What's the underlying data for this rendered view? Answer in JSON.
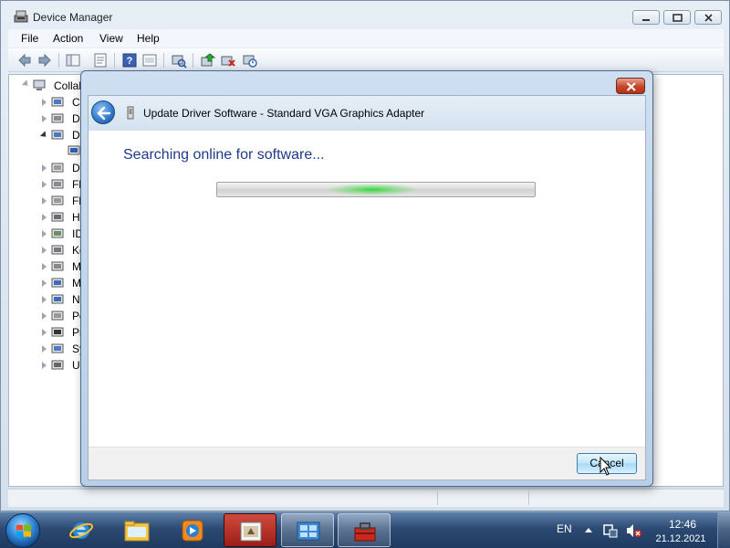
{
  "window": {
    "title": "Device Manager",
    "icon": "device-manager-icon",
    "caption_buttons": [
      "minimize",
      "maximize",
      "close"
    ]
  },
  "menu": {
    "items": [
      {
        "label": "File"
      },
      {
        "label": "Action"
      },
      {
        "label": "View"
      },
      {
        "label": "Help"
      }
    ]
  },
  "toolbar": {
    "buttons": [
      "back-arrow-icon",
      "forward-arrow-icon",
      "properties-pane-icon",
      "properties-sheet-icon",
      "help-icon",
      "show-hidden-icon",
      "scan-hardware-icon",
      "update-driver-icon",
      "uninstall-device-icon",
      "disable-device-icon"
    ]
  },
  "tree": {
    "root": {
      "label": "Collab"
    },
    "categories": [
      {
        "label": "Co",
        "icon": "computer-icon"
      },
      {
        "label": "Di",
        "icon": "disk-drive-icon"
      },
      {
        "label": "Di",
        "icon": "display-adapter-icon",
        "expanded": true
      },
      {
        "label": "DV",
        "icon": "dvd-drive-icon"
      },
      {
        "label": "Fl",
        "icon": "floppy-controller-icon"
      },
      {
        "label": "Fl",
        "icon": "floppy-drive-icon"
      },
      {
        "label": "Hu",
        "icon": "hid-icon"
      },
      {
        "label": "ID",
        "icon": "ide-controller-icon"
      },
      {
        "label": "Ke",
        "icon": "keyboard-icon"
      },
      {
        "label": "M",
        "icon": "mouse-icon"
      },
      {
        "label": "M",
        "icon": "monitor-icon"
      },
      {
        "label": "Ne",
        "icon": "network-adapter-icon"
      },
      {
        "label": "Po",
        "icon": "ports-icon"
      },
      {
        "label": "Pr",
        "icon": "processor-icon"
      },
      {
        "label": "Sy",
        "icon": "system-devices-icon"
      },
      {
        "label": "Ur",
        "icon": "usb-controller-icon"
      }
    ]
  },
  "dialog": {
    "title": "Update Driver Software - Standard VGA Graphics Adapter",
    "heading": "Searching online for software...",
    "progress": {
      "state": "marquee"
    },
    "cancel_label": "Cancel",
    "accent": "#1e3a8a"
  },
  "taskbar": {
    "pinned": [
      "internet-explorer-icon",
      "windows-explorer-icon",
      "media-player-icon"
    ],
    "running": [
      "device-manager-task-icon",
      "control-panel-icon",
      "toolbox-icon"
    ],
    "language": "EN",
    "time": "12:46",
    "date": "21.12.2021"
  }
}
